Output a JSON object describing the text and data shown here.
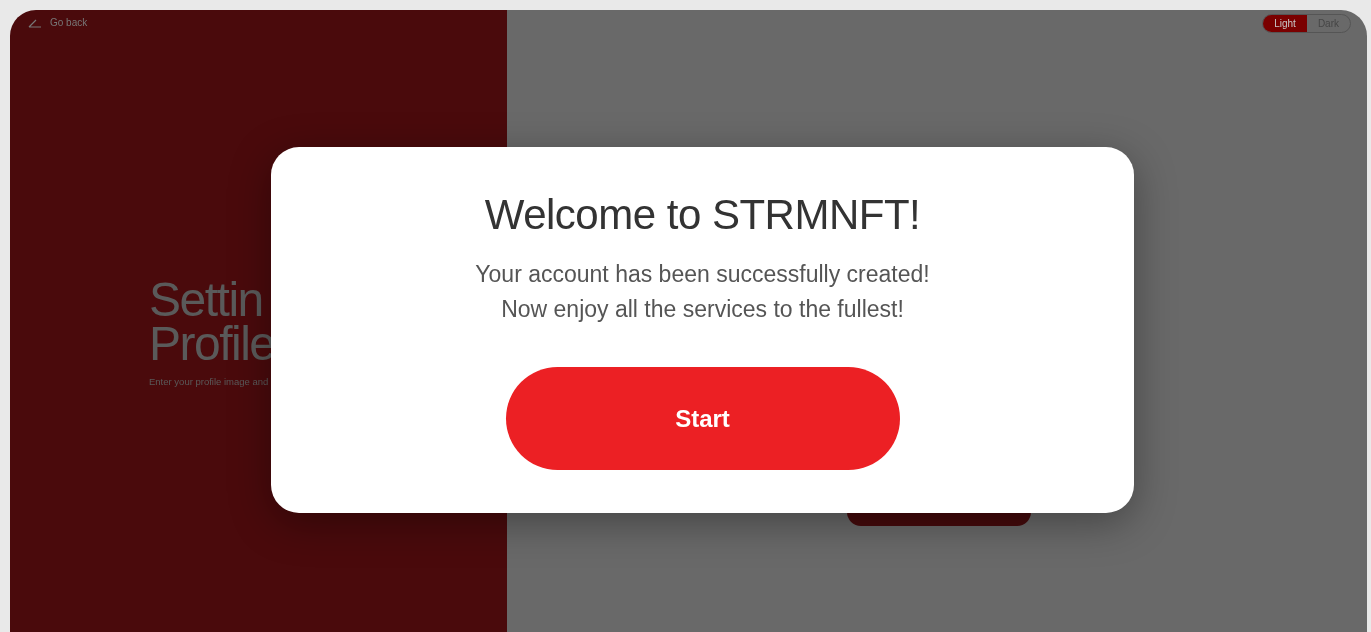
{
  "header": {
    "back_link": "Go back"
  },
  "theme_toggle": [
    {
      "label": "Light",
      "selected": true
    },
    {
      "label": "Dark",
      "selected": false
    }
  ],
  "left_panel": {
    "title_lines": [
      "Settin",
      "Profile"
    ],
    "subtitle": "Enter your profile image and"
  },
  "modal": {
    "title": "Welcome to STRMNFT!",
    "message_lines": [
      "Your account has been successfully created!",
      "Now enjoy all the services to the fullest!"
    ],
    "button": "Start"
  }
}
